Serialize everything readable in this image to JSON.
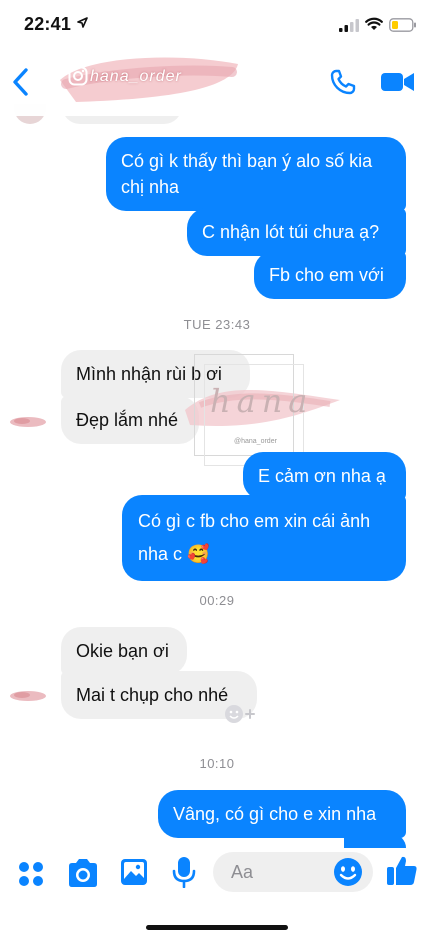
{
  "status_bar": {
    "time": "22:41"
  },
  "header": {
    "contact_name": "hana_order"
  },
  "messages": [
    {
      "type": "outgoing",
      "text": "Có gì k thấy thì bạn ý alo số kia chị nha"
    },
    {
      "type": "outgoing",
      "text": "C nhận lót túi chưa ạ?"
    },
    {
      "type": "outgoing",
      "text": "Fb cho em với"
    },
    {
      "type": "timestamp",
      "text": "TUE 23:43"
    },
    {
      "type": "incoming",
      "text": "Mình nhận rùi b ơi"
    },
    {
      "type": "incoming",
      "text": "Đẹp lắm nhé"
    },
    {
      "type": "outgoing",
      "text": "E cảm ơn nha ạ"
    },
    {
      "type": "outgoing",
      "text": "Có gì c fb cho em xin cái ảnh nha c 🥰"
    },
    {
      "type": "timestamp",
      "text": "00:29"
    },
    {
      "type": "incoming",
      "text": "Okie bạn ơi"
    },
    {
      "type": "incoming",
      "text": "Mai t chụp cho nhé"
    },
    {
      "type": "timestamp",
      "text": "10:10"
    },
    {
      "type": "outgoing",
      "text": "Vâng, có gì cho e xin nha"
    }
  ],
  "watermark": {
    "script": "hana",
    "small": "@hana_order"
  },
  "composer": {
    "placeholder": "Aa"
  },
  "icons": {
    "back": "chevron-left-icon",
    "call": "phone-icon",
    "video": "video-camera-icon",
    "more": "four-dots-icon",
    "camera": "camera-icon",
    "gallery": "image-icon",
    "mic": "microphone-icon",
    "emoji": "smiley-icon",
    "like": "thumbs-up-icon"
  },
  "colors": {
    "accent": "#0a84ff",
    "incoming_bubble": "#efefef",
    "timestamp": "#8e8e93"
  }
}
